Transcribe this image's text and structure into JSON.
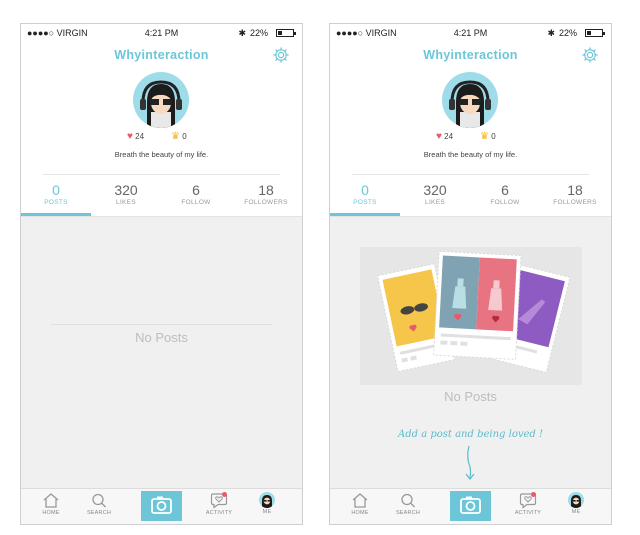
{
  "status_bar": {
    "carrier": "●●●●○ VIRGIN",
    "time": "4:21 PM",
    "battery": "22%"
  },
  "app": {
    "title": "Whyinteraction"
  },
  "profile": {
    "likes": "24",
    "crowns": "0",
    "bio": "Breath the beauty of my life."
  },
  "tabs": [
    {
      "value": "0",
      "label": "POSTS"
    },
    {
      "value": "320",
      "label": "LIKES"
    },
    {
      "value": "6",
      "label": "FOLLOW"
    },
    {
      "value": "18",
      "label": "FOLLOWERS"
    }
  ],
  "empty_state": {
    "message": "No Posts",
    "hint": "Add a post and being loved !"
  },
  "tab_bar": {
    "home": "HOME",
    "search": "SEARCH",
    "activity": "ACTIVITY",
    "me": "ME"
  },
  "colors": {
    "accent": "#6cc6d8",
    "heart": "#e85a6b",
    "crown": "#f3b51a"
  }
}
